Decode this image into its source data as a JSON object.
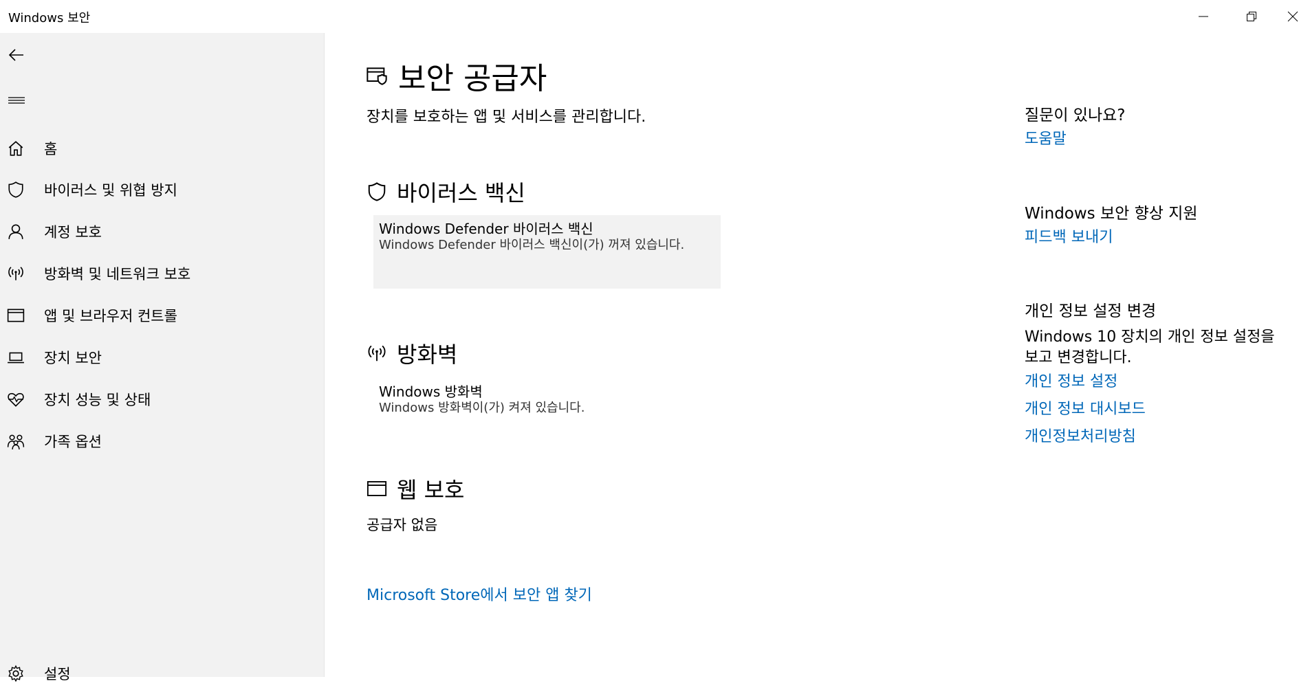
{
  "window": {
    "title": "Windows 보안"
  },
  "sidebar": {
    "items": [
      {
        "label": "홈",
        "icon": "home-icon"
      },
      {
        "label": "바이러스 및 위협 방지",
        "icon": "shield-icon"
      },
      {
        "label": "계정 보호",
        "icon": "person-icon"
      },
      {
        "label": "방화벽 및 네트워크 보호",
        "icon": "antenna-icon"
      },
      {
        "label": "앱 및 브라우저 컨트롤",
        "icon": "browser-window-icon"
      },
      {
        "label": "장치 보안",
        "icon": "laptop-icon"
      },
      {
        "label": "장치 성능 및 상태",
        "icon": "heart-pulse-icon"
      },
      {
        "label": "가족 옵션",
        "icon": "family-icon"
      }
    ],
    "settings_label": "설정"
  },
  "main": {
    "title": "보안 공급자",
    "subtitle": "장치를 보호하는 앱 및 서비스를 관리합니다.",
    "sections": {
      "antivirus": {
        "title": "바이러스 백신",
        "provider_name": "Windows Defender 바이러스 백신",
        "provider_status": "Windows Defender 바이러스 백신이(가) 꺼져 있습니다."
      },
      "firewall": {
        "title": "방화벽",
        "provider_name": "Windows 방화벽",
        "provider_status": "Windows 방화벽이(가) 켜져 있습니다."
      },
      "web": {
        "title": "웹 보호",
        "empty_text": "공급자 없음"
      }
    },
    "store_link": "Microsoft Store에서 보안 앱 찾기"
  },
  "right": {
    "question": {
      "heading": "질문이 있나요?",
      "link": "도움말"
    },
    "improve": {
      "heading": "Windows 보안 향상 지원",
      "link": "피드백 보내기"
    },
    "privacy": {
      "heading": "개인 정보 설정 변경",
      "text": "Windows 10 장치의 개인 정보 설정을 보고 변경합니다.",
      "links": [
        "개인 정보 설정",
        "개인 정보 대시보드",
        "개인정보처리방침"
      ]
    }
  },
  "colors": {
    "accent": "#0067b8",
    "sidebar_bg": "#f2f2f2",
    "card_bg": "#f2f2f2"
  }
}
